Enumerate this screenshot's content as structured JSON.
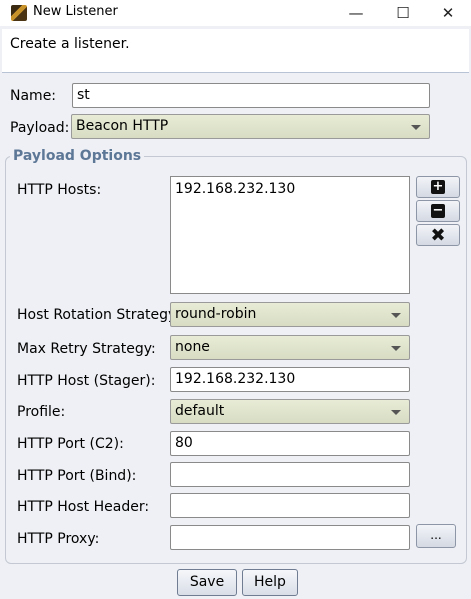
{
  "window": {
    "title": "New Listener",
    "minimize": "—",
    "maximize": "☐",
    "close": "✕"
  },
  "banner": {
    "text": "Create a listener."
  },
  "name": {
    "label": "Name:",
    "value": "st"
  },
  "payload": {
    "label": "Payload:",
    "value": "Beacon HTTP"
  },
  "options": {
    "group_title": "Payload Options",
    "http_hosts": {
      "label": "HTTP Hosts:",
      "values": [
        "192.168.232.130"
      ]
    },
    "buttons": {
      "add": "+",
      "remove": "−",
      "clear": "✖"
    },
    "host_rotation": {
      "label": "Host Rotation Strategy:",
      "value": "round-robin"
    },
    "max_retry": {
      "label": "Max Retry Strategy:",
      "value": "none"
    },
    "http_host_stager": {
      "label": "HTTP Host (Stager):",
      "value": "192.168.232.130"
    },
    "profile": {
      "label": "Profile:",
      "value": "default"
    },
    "http_port_c2": {
      "label": "HTTP Port (C2):",
      "value": "80"
    },
    "http_port_bind": {
      "label": "HTTP Port (Bind):",
      "value": ""
    },
    "http_host_header": {
      "label": "HTTP Host Header:",
      "value": ""
    },
    "http_proxy": {
      "label": "HTTP Proxy:",
      "value": "",
      "browse": "..."
    }
  },
  "footer": {
    "save": "Save",
    "help": "Help"
  }
}
